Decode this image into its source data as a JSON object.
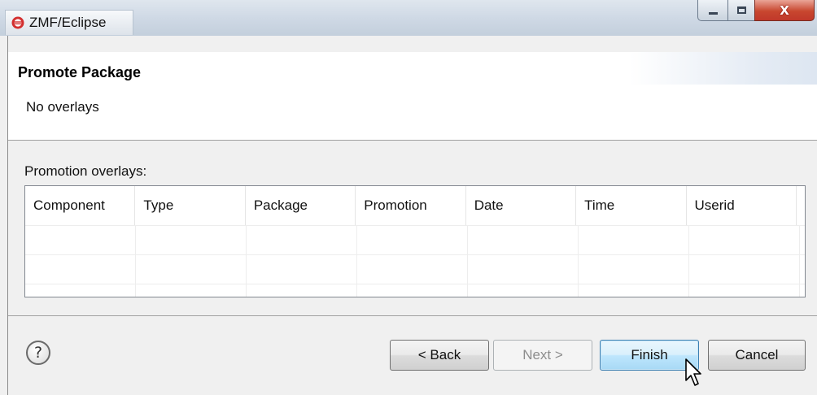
{
  "window": {
    "title": "ZMF/Eclipse",
    "icons": {
      "app": "eclipse-zmf-icon",
      "minimize": "minimize-icon",
      "maximize": "maximize-icon",
      "close": "close-icon"
    },
    "close_glyph": "X"
  },
  "header": {
    "title": "Promote Package",
    "message": "No overlays"
  },
  "overlays": {
    "label": "Promotion overlays:",
    "columns": [
      "Component",
      "Type",
      "Package",
      "Promotion",
      "Date",
      "Time",
      "Userid"
    ],
    "rows": []
  },
  "footer": {
    "help_icon": "help-icon",
    "help_glyph": "?",
    "back_label": "< Back",
    "next_label": "Next >",
    "finish_label": "Finish",
    "cancel_label": "Cancel"
  },
  "colors": {
    "close_button": "#c8472f",
    "default_button_border": "#3c7fb1"
  }
}
